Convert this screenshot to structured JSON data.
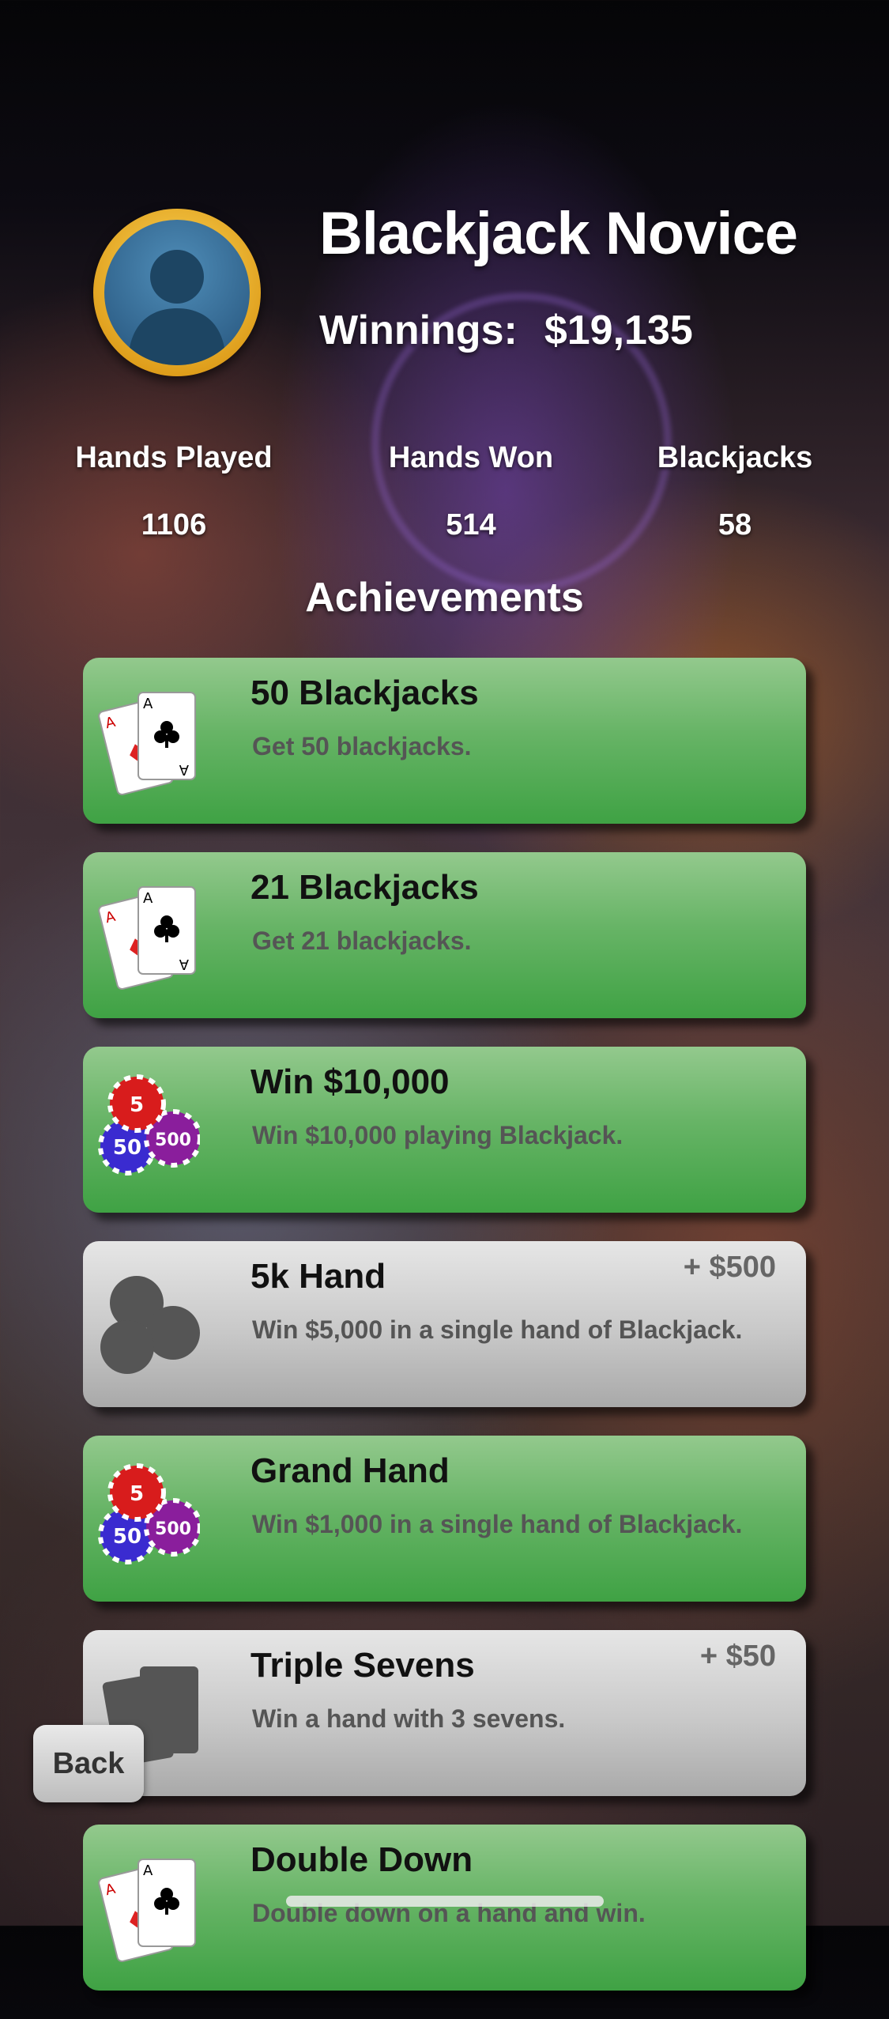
{
  "profile": {
    "title": "Blackjack Novice",
    "winnings_label": "Winnings:",
    "winnings_value": "$19,135"
  },
  "stats": [
    {
      "label": "Hands Played",
      "value": "1106"
    },
    {
      "label": "Hands Won",
      "value": "514"
    },
    {
      "label": "Blackjacks",
      "value": "58"
    }
  ],
  "achievements_title": "Achievements",
  "achievements": [
    {
      "name": "50 Blackjacks",
      "desc": "Get 50 blackjacks.",
      "reward": "",
      "status": "unlocked",
      "icon": "aces-cards-icon"
    },
    {
      "name": "21 Blackjacks",
      "desc": "Get 21 blackjacks.",
      "reward": "",
      "status": "unlocked",
      "icon": "aces-cards-icon"
    },
    {
      "name": "Win $10,000",
      "desc": "Win $10,000 playing Blackjack.",
      "reward": "",
      "status": "unlocked",
      "icon": "poker-chips-icon"
    },
    {
      "name": "5k Hand",
      "desc": "Win $5,000 in a single hand of Blackjack.",
      "reward": "+ $500",
      "status": "locked",
      "icon": "poker-chips-silhouette-icon"
    },
    {
      "name": "Grand Hand",
      "desc": "Win $1,000 in a single hand of Blackjack.",
      "reward": "",
      "status": "unlocked",
      "icon": "poker-chips-icon"
    },
    {
      "name": "Triple Sevens",
      "desc": "Win a hand with 3 sevens.",
      "reward": "+ $50",
      "status": "locked",
      "icon": "cards-silhouette-icon"
    },
    {
      "name": "Double Down",
      "desc": "Double down on a hand and win.",
      "reward": "",
      "status": "unlocked",
      "icon": "aces-cards-icon"
    }
  ],
  "back_label": "Back",
  "colors": {
    "unlocked": "#5cae5a",
    "locked": "#c4c4c4",
    "avatar_ring": "#f0a818"
  }
}
